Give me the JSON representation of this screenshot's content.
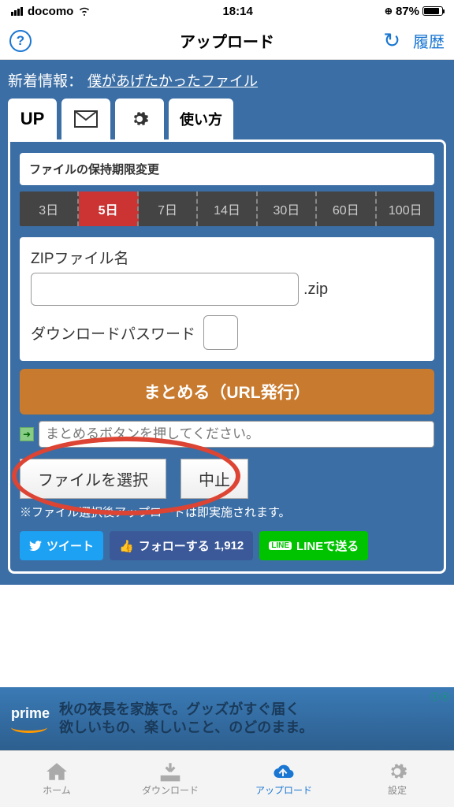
{
  "status": {
    "carrier": "docomo",
    "time": "18:14",
    "battery": "87%"
  },
  "nav": {
    "title": "アップロード",
    "history": "履歴"
  },
  "news": {
    "label": "新着情報：",
    "link": "僕があげたかったファイル"
  },
  "tabs": {
    "up": "UP",
    "howto": "使い方"
  },
  "retention": {
    "label": "ファイルの保持期限変更",
    "days": [
      "3日",
      "5日",
      "7日",
      "14日",
      "30日",
      "60日",
      "100日"
    ],
    "selected": 1
  },
  "form": {
    "zip_label": "ZIPファイル名",
    "zip_ext": ".zip",
    "pw_label": "ダウンロードパスワード"
  },
  "action": {
    "combine": "まとめる（URL発行）",
    "url_placeholder": "まとめるボタンを押してください。",
    "choose": "ファイルを選択",
    "cancel": "中止",
    "note": "※ファイル選択後アップロードは即実施されます。"
  },
  "social": {
    "tweet": "ツイート",
    "follow": "フォローする",
    "follow_count": "1,912",
    "line": "LINEで送る"
  },
  "ad": {
    "brand": "prime",
    "line1": "秋の夜長を家族で。グッズがすぐ届く",
    "line2": "欲しいもの、楽しいこと、のどのまま。"
  },
  "tabbar": {
    "home": "ホーム",
    "download": "ダウンロード",
    "upload": "アップロード",
    "settings": "設定"
  }
}
